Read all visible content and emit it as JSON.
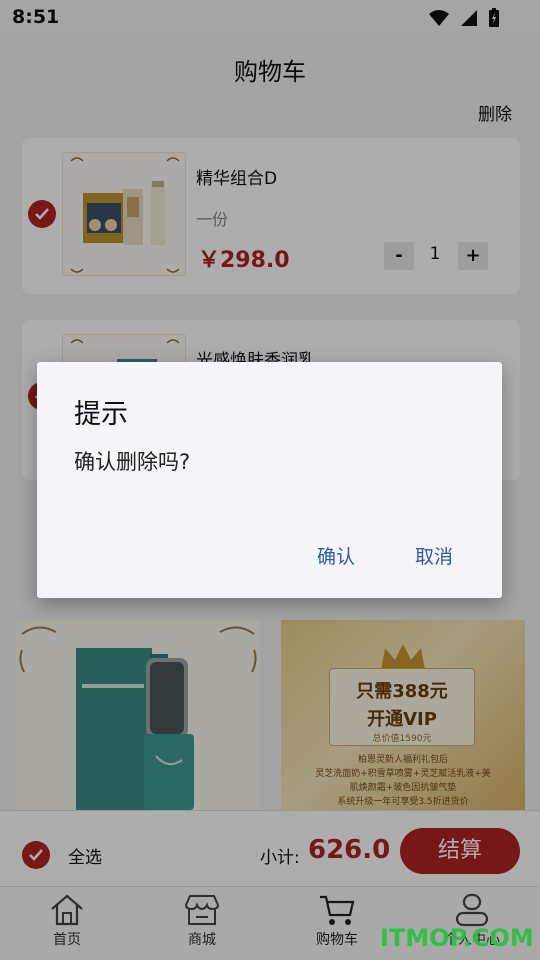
{
  "status_bar": {
    "time": "8:51"
  },
  "header": {
    "title": "购物车",
    "delete_label": "删除"
  },
  "cart_items": [
    {
      "name": "精华组合D",
      "spec": "一份",
      "price": "￥298.0",
      "qty_minus": "-",
      "qty": "1",
      "qty_plus": "+"
    },
    {
      "name": "光感焕肤香润乳"
    }
  ],
  "promo": {
    "vip_line1": "只需388元",
    "vip_line2": "开通VIP",
    "vip_tag": "总价值1590元",
    "small_1": "柏恩灵新人福利礼包后",
    "small_2": "灵芝洗面奶+积雪草喷雾+灵芝赋活乳液+美",
    "small_3": "肌焕颜霜+玻色因抗皱气垫",
    "small_4": "系统升级一年可享受3.5折进货价"
  },
  "summary": {
    "select_all": "全选",
    "subtotal_label": "小计:",
    "subtotal_value": "626.0",
    "checkout": "结算"
  },
  "nav": {
    "home": "首页",
    "mall": "商城",
    "cart": "购物车",
    "profile": "个人中心"
  },
  "dialog": {
    "title": "提示",
    "message": "确认删除吗?",
    "confirm": "确认",
    "cancel": "取消"
  },
  "watermark": "ITMOP.COM",
  "colors": {
    "accent": "#b22222",
    "dialog_button": "#2e5aa8"
  }
}
